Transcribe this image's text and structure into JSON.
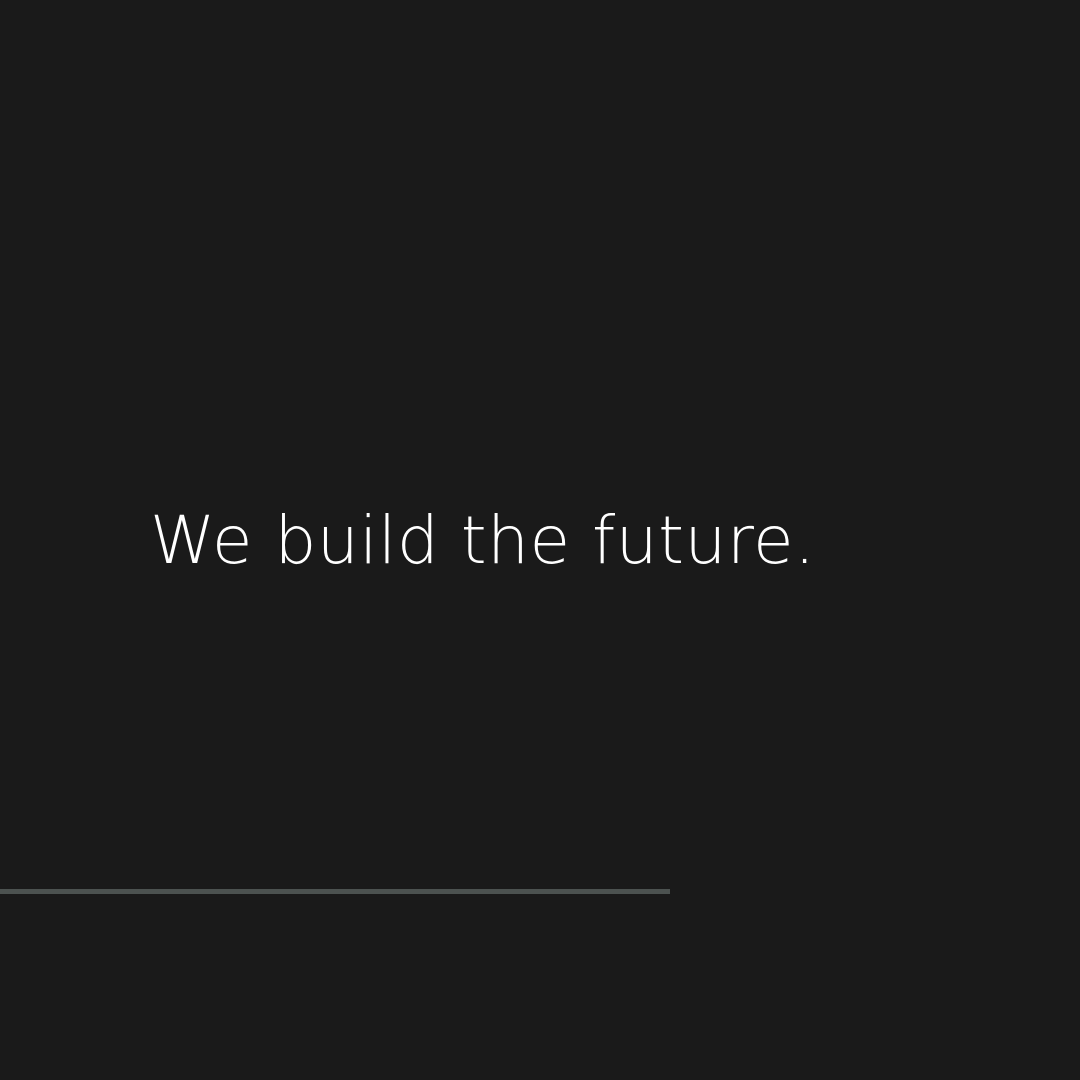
{
  "hero": {
    "tagline": "We build the future."
  },
  "colors": {
    "background": "#1a1a1a",
    "text": "#ffffff",
    "rule": "#4c5250"
  }
}
